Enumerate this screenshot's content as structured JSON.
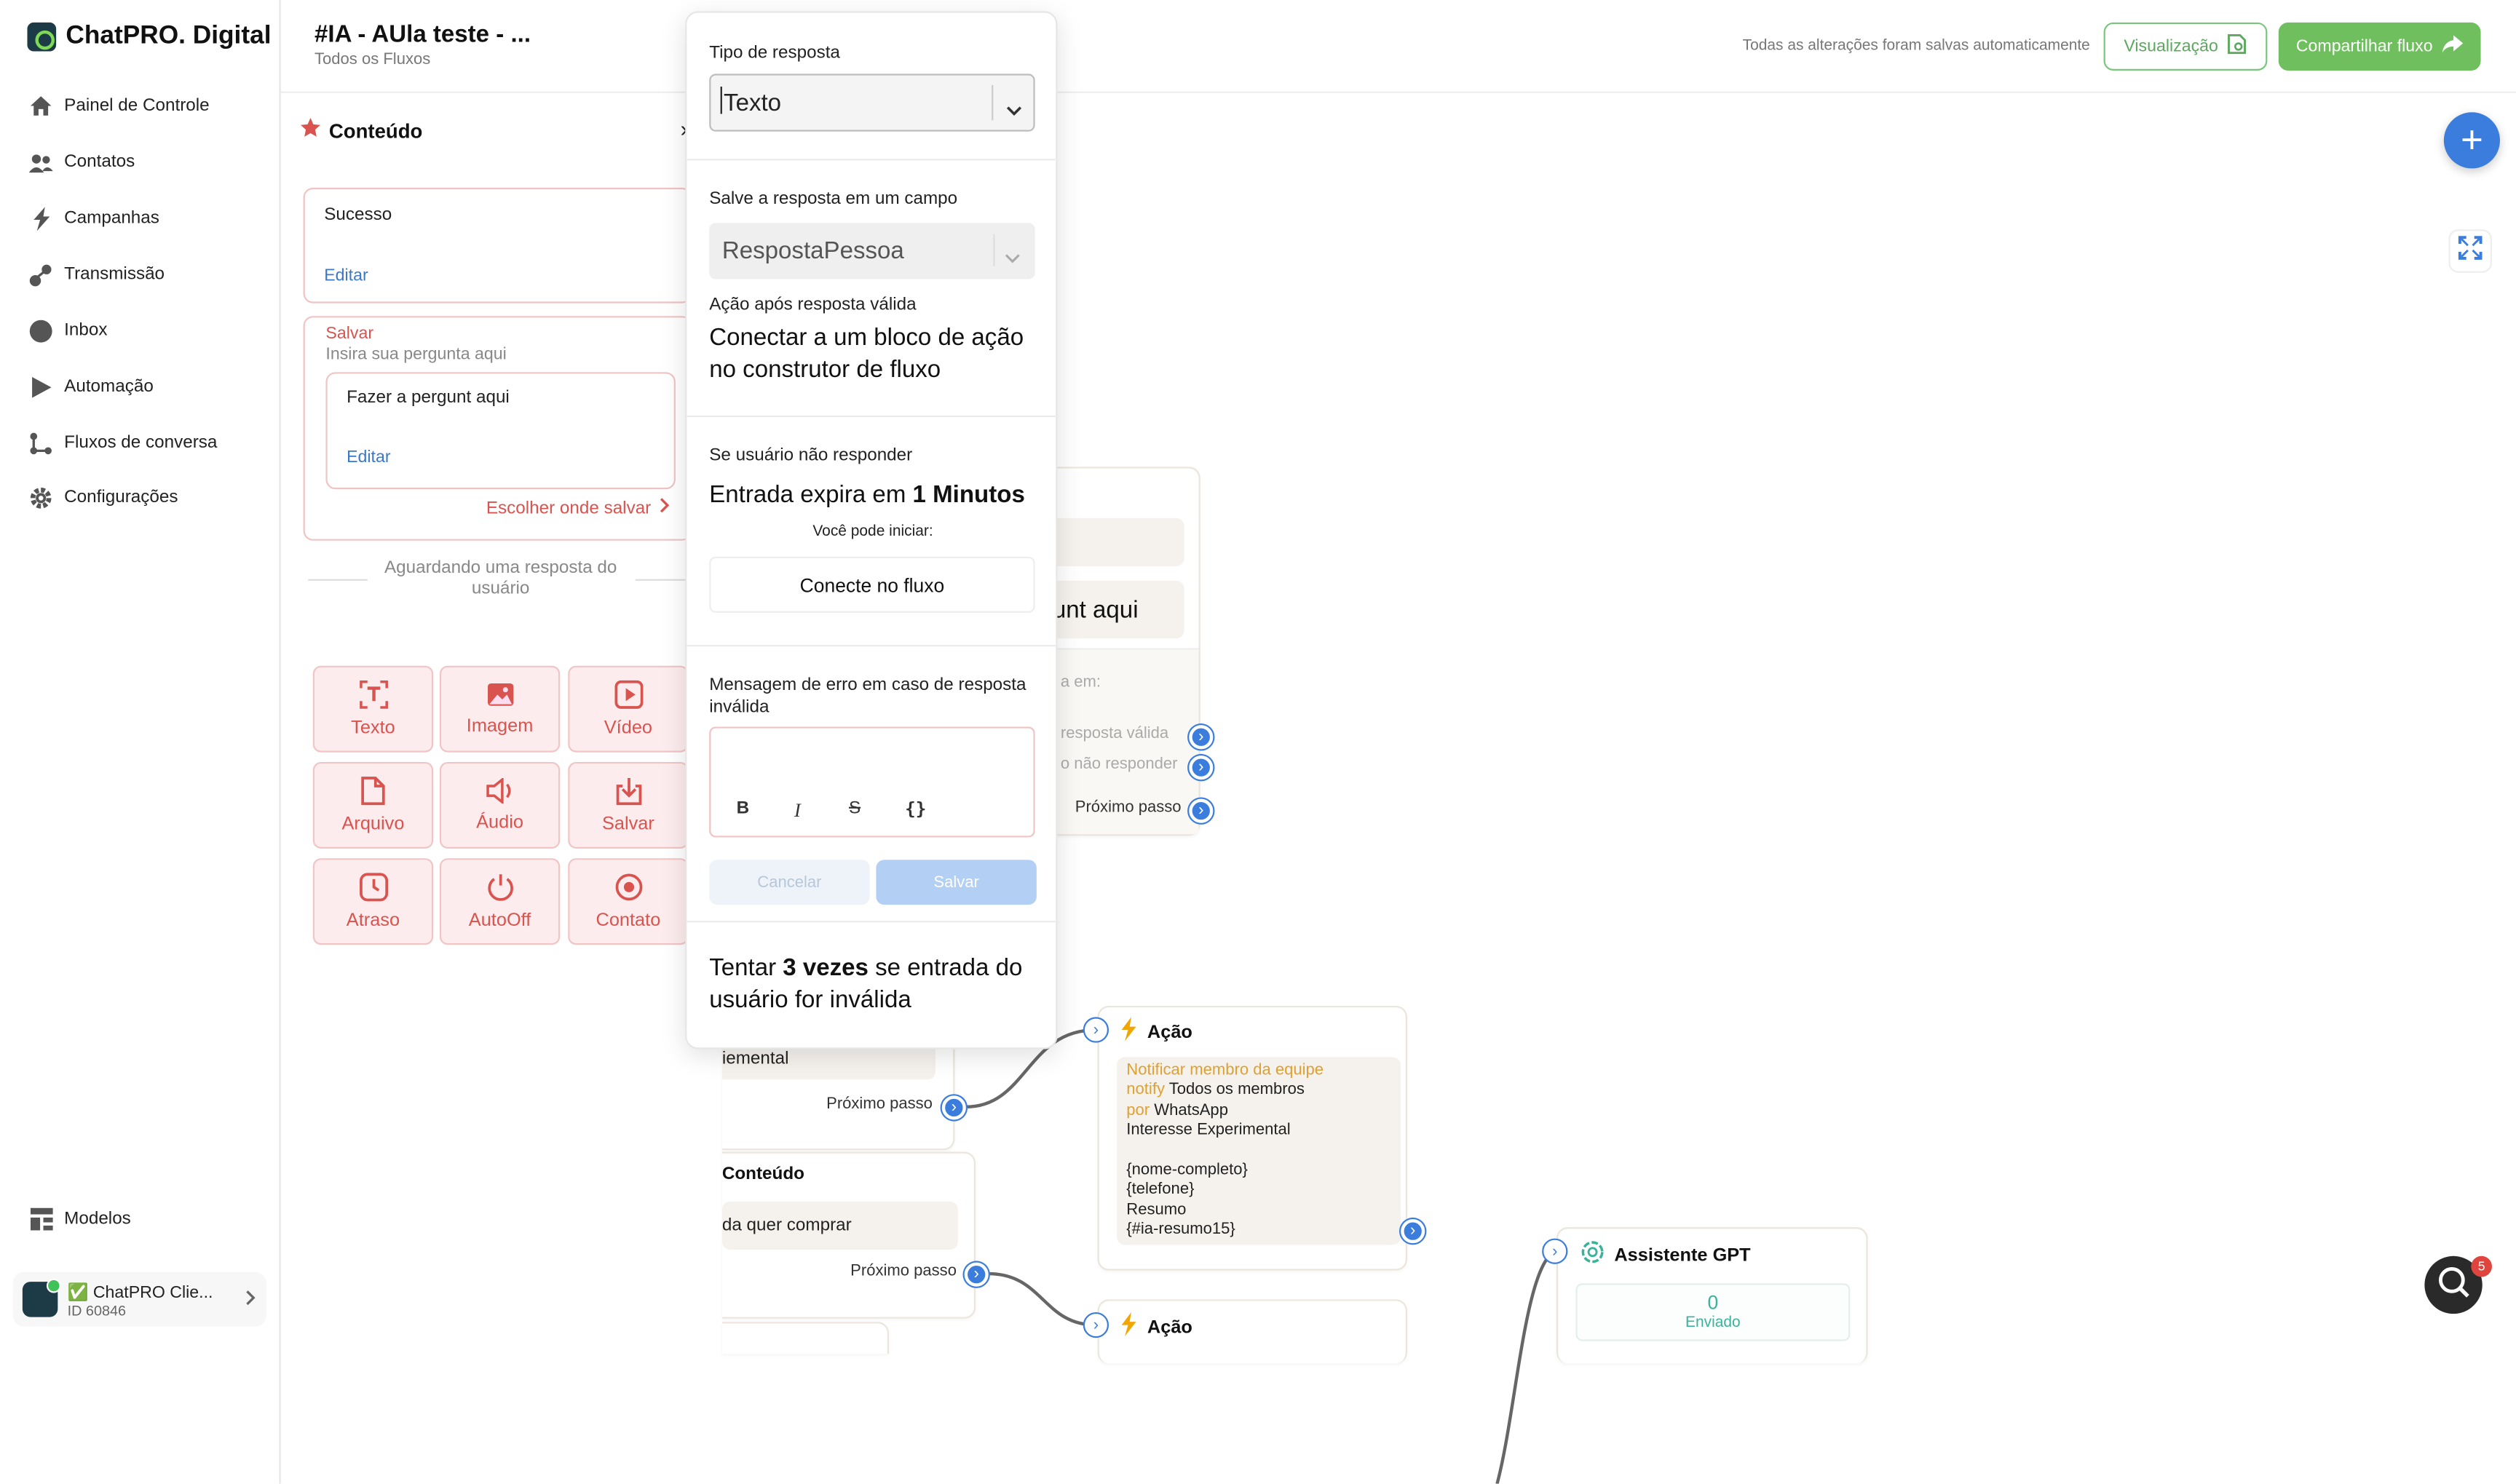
{
  "app": {
    "name": "ChatPRO. Digital"
  },
  "sidebar": {
    "items": [
      {
        "label": "Painel de Controle",
        "icon": "home-icon"
      },
      {
        "label": "Contatos",
        "icon": "users-icon"
      },
      {
        "label": "Campanhas",
        "icon": "bolt-icon"
      },
      {
        "label": "Transmissão",
        "icon": "broadcast-icon"
      },
      {
        "label": "Inbox",
        "icon": "chat-icon"
      },
      {
        "label": "Automação",
        "icon": "play-icon"
      },
      {
        "label": "Fluxos de conversa",
        "icon": "flow-icon"
      },
      {
        "label": "Configurações",
        "icon": "gear-icon"
      }
    ],
    "models": "Modelos",
    "account": {
      "name": "✅ ChatPRO Clie...",
      "id": "ID 60846"
    }
  },
  "header": {
    "title": "#IA - AUla teste - ...",
    "breadcrumb": "Todos os Fluxos",
    "saved_status": "Todas as alterações foram salvas automaticamente",
    "preview_label": "Visualização",
    "share_label": "Compartilhar fluxo"
  },
  "panel": {
    "title": "Conteúdo",
    "card1": {
      "text": "Sucesso",
      "edit": "Editar"
    },
    "card2": {
      "tag": "Salvar",
      "placeholder": "Insira sua pergunta aqui",
      "question": "Fazer a pergunt aqui",
      "edit": "Editar",
      "choose": "Escolher onde salvar"
    },
    "waiting": "Aguardando uma resposta do usuário",
    "blocks": [
      "Texto",
      "Imagem",
      "Vídeo",
      "Arquivo",
      "Áudio",
      "Salvar",
      "Atraso",
      "AutoOff",
      "Contato"
    ]
  },
  "modal": {
    "response_type_label": "Tipo de resposta",
    "response_type_value": "Texto",
    "save_field_label": "Salve a resposta em um campo",
    "save_field_value": "RespostaPessoa",
    "valid_action_label": "Ação após resposta válida",
    "valid_action_text": "Conectar a um bloco de ação no construtor de fluxo",
    "no_reply_label": "Se usuário não responder",
    "expires_prefix": "Entrada expira em ",
    "expires_value": "1 Minutos",
    "can_start": "Você pode iniciar:",
    "connect_label": "Conecte no fluxo",
    "error_msg_label": "Mensagem de erro em caso de resposta inválida",
    "toolbar": {
      "bold": "B",
      "italic": "I",
      "strike": "S",
      "var": "{}"
    },
    "cancel": "Cancelar",
    "save": "Salvar",
    "retry_prefix": "Tentar ",
    "retry_value": "3 vezes",
    "retry_suffix": " se entrada do usuário for inválida"
  },
  "canvas": {
    "node_partial_text": "unt aqui",
    "partial_wait": "a em:",
    "partial_valid": "resposta válida",
    "partial_noreply": "o não responder",
    "next_step": "Próximo passo",
    "node_experimental": "iemental",
    "content_title": "Conteúdo",
    "content_text": "da quer comprar",
    "action_title": "Ação",
    "action": {
      "header": "Notificar membro da equipe",
      "notify_key": "notify",
      "notify_val": "Todos os membros",
      "por_key": "por",
      "por_val": "WhatsApp",
      "lines": [
        "Interesse Experimental",
        "",
        "{nome-completo}",
        "{telefone}",
        "Resumo",
        "{#ia-resumo15}"
      ]
    },
    "gpt_title": "Assistente GPT",
    "gpt_count": "0",
    "gpt_sent": "Enviado",
    "chat_badge": "5"
  },
  "colors": {
    "accent": "#3b7ddd",
    "green": "#6fbf5f",
    "red": "#d9534f"
  }
}
